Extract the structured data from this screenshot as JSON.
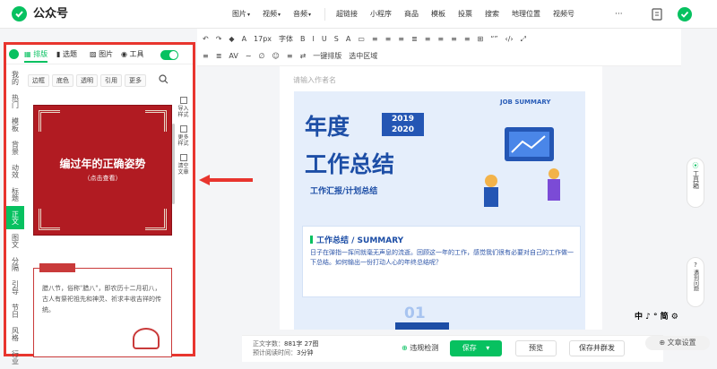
{
  "app": {
    "title": "公众号"
  },
  "topnav": {
    "group1": [
      "图片",
      "视频",
      "音频"
    ],
    "group2": [
      "超链接",
      "小程序",
      "商品",
      "模板",
      "投票",
      "搜索",
      "地理位置",
      "视频号"
    ],
    "more": "···"
  },
  "toolbar": {
    "row1": [
      "↶",
      "↷",
      "◆",
      "A",
      "17px",
      "字体",
      "B",
      "I",
      "U",
      "S",
      "A",
      "▭",
      "≡",
      "≡",
      "≡",
      "≣",
      "≡",
      "≡",
      "≡",
      "≡",
      "⊞",
      "“”",
      "‹/›",
      "⤢"
    ],
    "row2": [
      "≡",
      "≣",
      "AV",
      "∼",
      "∅",
      "☺",
      "≡",
      "⇄",
      "一键排版",
      "选中区域"
    ]
  },
  "panel": {
    "tabs": [
      "排版",
      "选题",
      "图片",
      "工具"
    ],
    "categories": [
      "我的",
      "热门",
      "模板",
      "背景",
      "动效",
      "标题",
      "正文",
      "图文",
      "分隔",
      "引导",
      "节日",
      "风格",
      "行业"
    ],
    "active_category": "正文",
    "chips": [
      "边框",
      "底色",
      "透明",
      "引用",
      "更多"
    ],
    "card1": {
      "title": "编过年的正确姿势",
      "sub": "（点击查看）"
    },
    "card2": {
      "text": "腊八节，俗称\"腊八\"，即农历十二月初八，古人有祭祀祖先和神灵、祈求丰收吉祥的传统。"
    },
    "side_buttons": [
      "导入样式",
      "更多样式",
      "清空文章"
    ]
  },
  "editor": {
    "author_placeholder": "请输入作者名",
    "poster": {
      "job_summary": "JOB SUMMARY",
      "big1": "年度",
      "big2": "工作总结",
      "badge": "2019\n2020",
      "sub": "工作汇报/计划总结",
      "summary_title": "工作总结 / SUMMARY",
      "summary_body": "日子在弹指一挥间就毫无声息的流逝。回顾这一年的工作，感觉我们很有必要对自己的工作做一下总结。如何输出一份打动人心的年终总结呢？",
      "num": "01"
    }
  },
  "status": {
    "words_label": "正文字数：",
    "words": "881字 27图",
    "time_label": "预计阅读时间：",
    "time": "3分钟",
    "check": "违规检测",
    "save": "保存",
    "preview": "预览",
    "publish": "保存并群发"
  },
  "rightrail": {
    "toolbox": "工具箱",
    "help": "遇到问题"
  },
  "ime": "中 ♪ ° 简 ⚙",
  "settings": "文章设置",
  "colors": {
    "brand": "#07c160",
    "highlight": "#e8352e"
  }
}
